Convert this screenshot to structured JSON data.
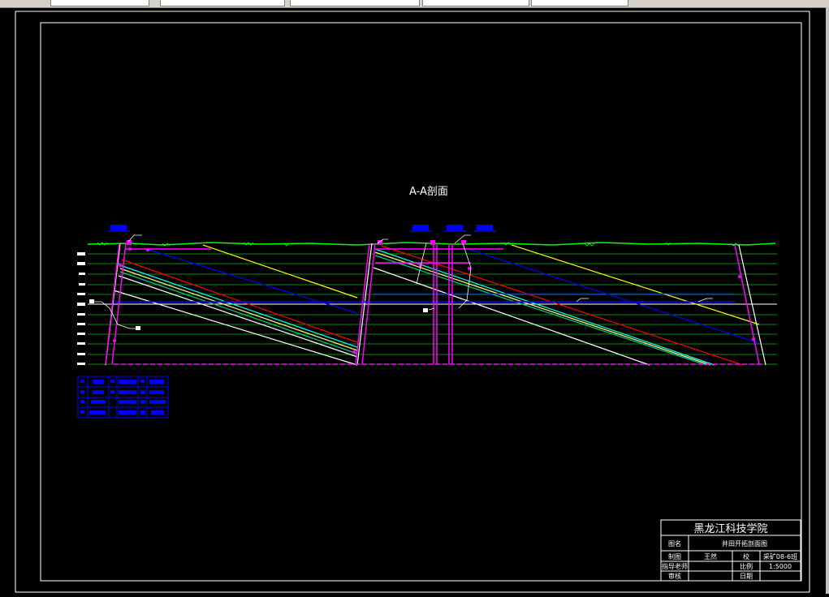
{
  "drawing": {
    "section_title": "A-A剖面"
  },
  "title_block": {
    "school": "黑龙江科技学院",
    "row1": {
      "label": "图名",
      "value": "井田开拓剖面图"
    },
    "row2": {
      "label": "制图",
      "value": "王然",
      "label2": "校",
      "value2": "采矿08-6班"
    },
    "row3": {
      "label": "指导老师",
      "value": "",
      "label2": "比例",
      "value2": "1:5000"
    },
    "row4": {
      "label": "审核",
      "value": "",
      "label2": "日期",
      "value2": ""
    }
  },
  "colors": {
    "ground": "#00ff00",
    "coal_seam_red": "#ff0000",
    "coal_seam_yellow": "#ffff00",
    "coal_seam_blue": "#0000ff",
    "shaft": "#ff00ff",
    "boundary": "#ffffff",
    "level_lines": "#00aa00"
  }
}
